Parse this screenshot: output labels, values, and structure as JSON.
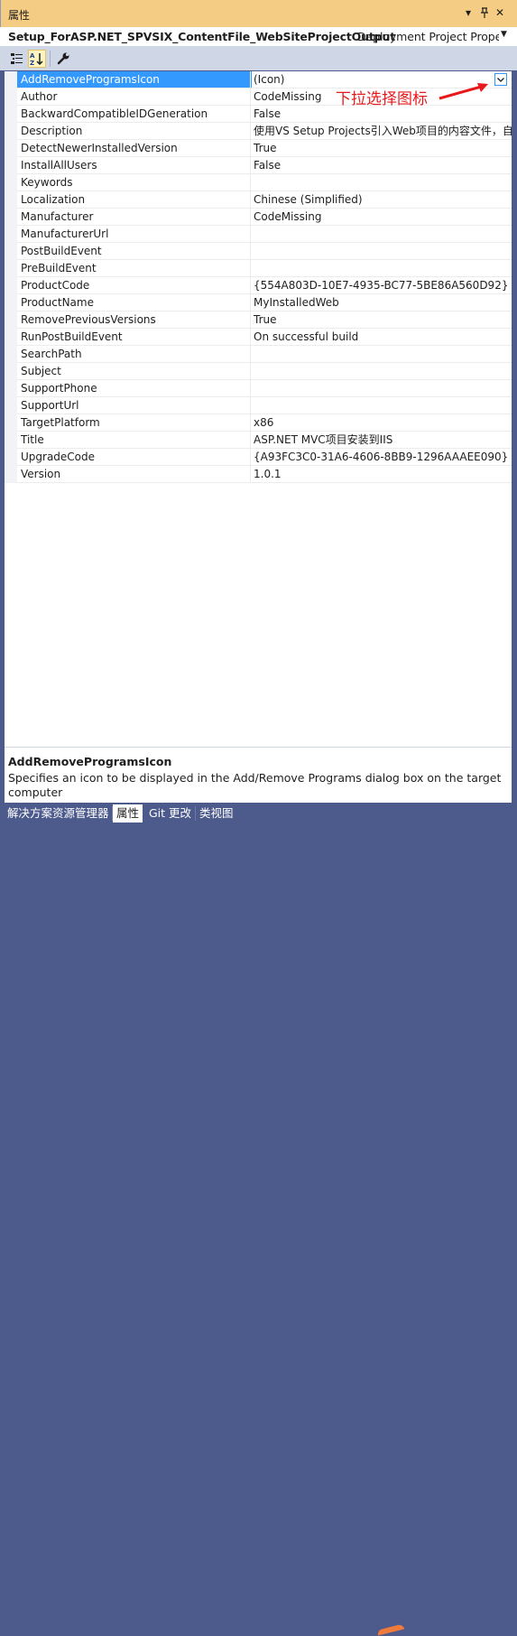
{
  "window": {
    "title": "属性",
    "buttons": [
      "▾",
      "ᚹ",
      "✕"
    ]
  },
  "object_bar": {
    "object_name": "Setup_ForASP.NET_SPVSIX_ContentFile_WebSiteProjectOutput",
    "object_type": "Deployment Project Proper",
    "dropdown_icon": "chevron-down-icon"
  },
  "toolbar": {
    "buttons": [
      "categorized-icon",
      "alphabetical-icon",
      "property-pages-icon"
    ],
    "active": "alphabetical-icon"
  },
  "annotation": {
    "text": "下拉选择图标",
    "color": "#e8191c"
  },
  "properties": [
    {
      "name": "AddRemoveProgramsIcon",
      "value": "(Icon)"
    },
    {
      "name": "Author",
      "value": "CodeMissing"
    },
    {
      "name": "BackwardCompatibleIDGeneration",
      "value": "False"
    },
    {
      "name": "Description",
      "value": "使用VS Setup Projects引入Web项目的内容文件，自"
    },
    {
      "name": "DetectNewerInstalledVersion",
      "value": "True"
    },
    {
      "name": "InstallAllUsers",
      "value": "False"
    },
    {
      "name": "Keywords",
      "value": ""
    },
    {
      "name": "Localization",
      "value": "Chinese (Simplified)"
    },
    {
      "name": "Manufacturer",
      "value": "CodeMissing"
    },
    {
      "name": "ManufacturerUrl",
      "value": ""
    },
    {
      "name": "PostBuildEvent",
      "value": ""
    },
    {
      "name": "PreBuildEvent",
      "value": ""
    },
    {
      "name": "ProductCode",
      "value": "{554A803D-10E7-4935-BC77-5BE86A560D92}"
    },
    {
      "name": "ProductName",
      "value": "MyInstalledWeb"
    },
    {
      "name": "RemovePreviousVersions",
      "value": "True"
    },
    {
      "name": "RunPostBuildEvent",
      "value": "On successful build"
    },
    {
      "name": "SearchPath",
      "value": ""
    },
    {
      "name": "Subject",
      "value": ""
    },
    {
      "name": "SupportPhone",
      "value": ""
    },
    {
      "name": "SupportUrl",
      "value": ""
    },
    {
      "name": "TargetPlatform",
      "value": "x86"
    },
    {
      "name": "Title",
      "value": "ASP.NET MVC项目安装到IIS"
    },
    {
      "name": "UpgradeCode",
      "value": "{A93FC3C0-31A6-4606-8BB9-1296AAAEE090}"
    },
    {
      "name": "Version",
      "value": "1.0.1"
    }
  ],
  "selected_property": "AddRemoveProgramsIcon",
  "description": {
    "title": "AddRemoveProgramsIcon",
    "text": "Specifies an icon to be displayed in the Add/Remove Programs dialog box on the target computer"
  },
  "tabs": [
    {
      "label": "解决方案资源管理器",
      "active": false
    },
    {
      "label": "属性",
      "active": true
    },
    {
      "label": "Git 更改",
      "active": false
    },
    {
      "label": "类视图",
      "active": false
    }
  ],
  "colors": {
    "selection": "#3399ff",
    "title_bar": "#f5cc84",
    "frame": "#4d5a8c"
  }
}
